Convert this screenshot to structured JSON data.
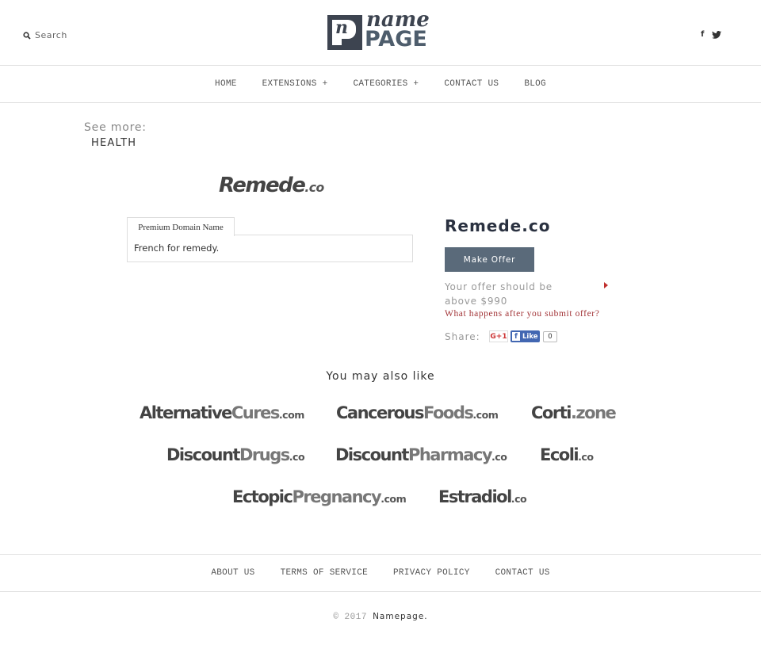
{
  "header": {
    "search_label": "Search",
    "logo": {
      "mark": "n",
      "word_top": "name",
      "word_bottom": "PAGE"
    },
    "social": {
      "facebook": "f"
    }
  },
  "nav": {
    "items": [
      {
        "label": "HOME"
      },
      {
        "label": "EXTENSIONS +"
      },
      {
        "label": "CATEGORIES +"
      },
      {
        "label": "CONTACT US"
      },
      {
        "label": "BLOG"
      }
    ]
  },
  "see_more": {
    "label": "See more:",
    "category": "HEALTH"
  },
  "domain": {
    "logo_name": "Remede",
    "logo_tld": ".co",
    "title": "Remede.co",
    "tab_label": "Premium Domain Name",
    "description": "French for remedy.",
    "make_offer_label": "Make Offer",
    "offer_note": "Your offer should be above $990",
    "offer_question": "What happens after you submit offer?",
    "share_label": "Share:",
    "gplus_label": "G+1",
    "fb_like_label": "Like",
    "fb_like_count": "0"
  },
  "related": {
    "heading": "You may also like",
    "items": [
      {
        "a": "Alternative",
        "b": "Cures",
        "tld": ".com"
      },
      {
        "a": "Cancerous",
        "b": "Foods",
        "tld": ".com"
      },
      {
        "a": "Corti",
        "b": "",
        "tld": ".zone"
      },
      {
        "a": "Discount",
        "b": "Drugs",
        "tld": ".co"
      },
      {
        "a": "Discount",
        "b": "Pharmacy",
        "tld": ".co"
      },
      {
        "a": "Ecoli",
        "b": "",
        "tld": ".co"
      },
      {
        "a": "Ectopic",
        "b": "Pregnancy",
        "tld": ".com"
      },
      {
        "a": "Estradiol",
        "b": "",
        "tld": ".co"
      }
    ]
  },
  "footer": {
    "links": [
      {
        "label": "ABOUT US"
      },
      {
        "label": "TERMS OF SERVICE"
      },
      {
        "label": "PRIVACY POLICY"
      },
      {
        "label": "CONTACT US"
      }
    ],
    "copyright": "© 2017",
    "brand": "Namepage."
  }
}
